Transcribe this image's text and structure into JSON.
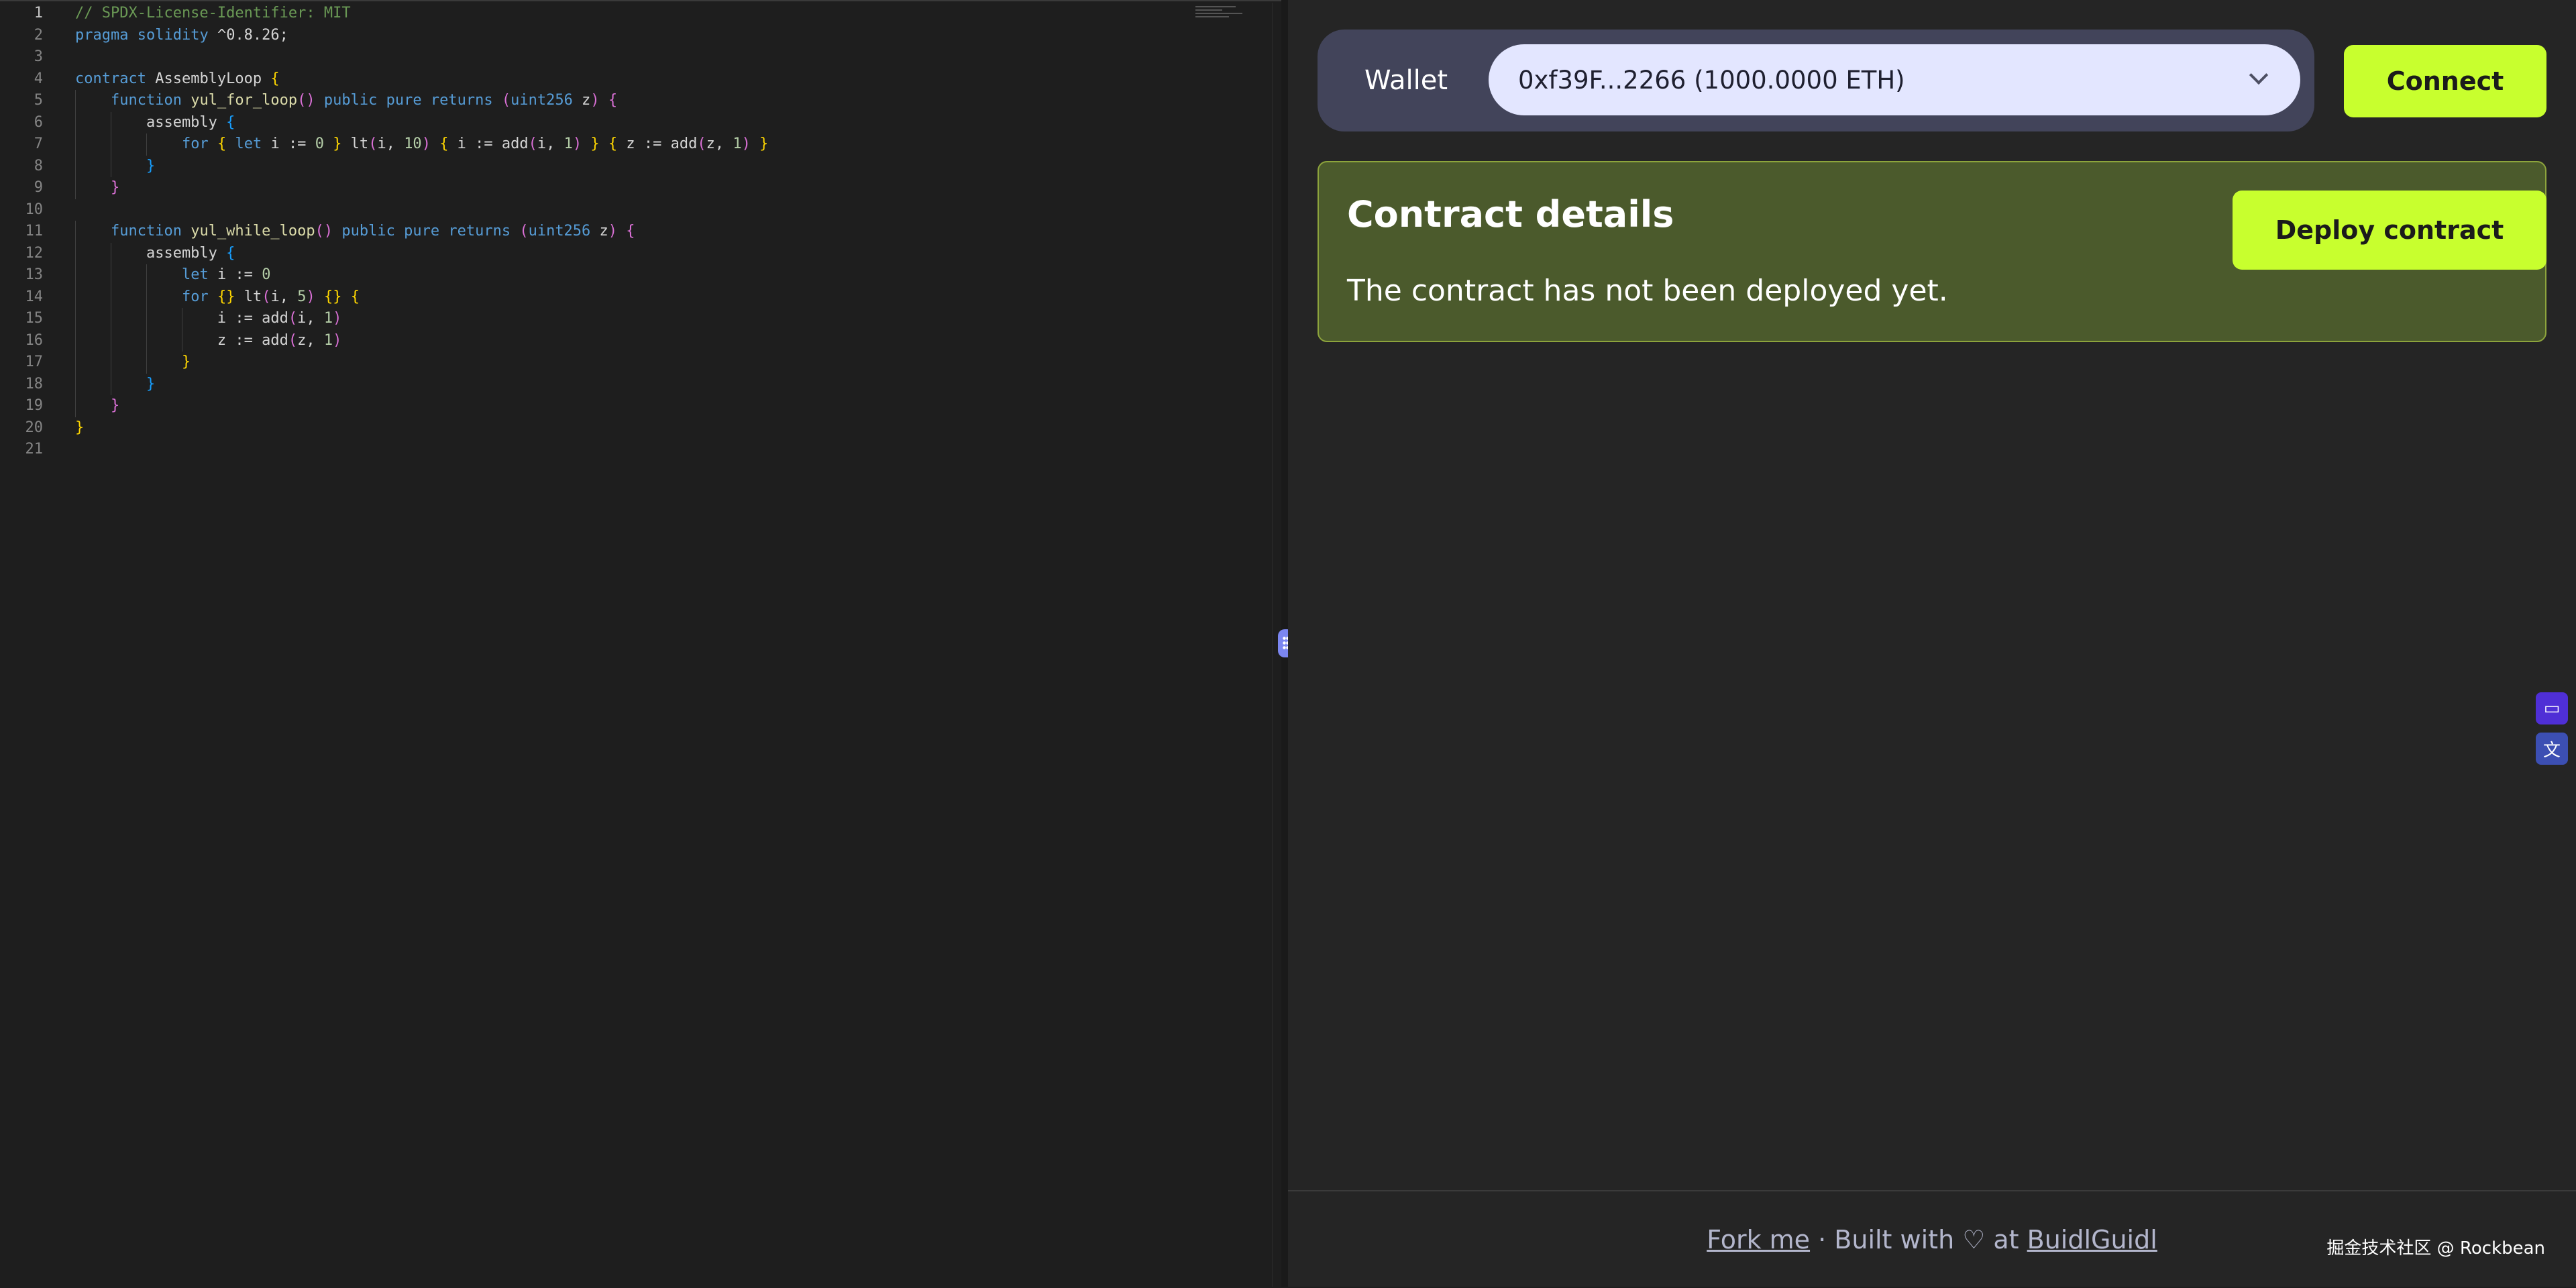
{
  "editor": {
    "lines": [
      [
        [
          "c-cm",
          "// SPDX-License-Identifier: MIT"
        ]
      ],
      [
        [
          "c-kw",
          "pragma"
        ],
        [
          "c-t",
          " "
        ],
        [
          "c-kw",
          "solidity"
        ],
        [
          "c-t",
          " ^0.8.26;"
        ]
      ],
      [],
      [
        [
          "c-kw",
          "contract"
        ],
        [
          "c-t",
          " AssemblyLoop "
        ],
        [
          "c-y",
          "{"
        ]
      ],
      [
        [
          "c-t",
          "    "
        ],
        [
          "c-kw",
          "function"
        ],
        [
          "c-t",
          " "
        ],
        [
          "c-fn",
          "yul_for_loop"
        ],
        [
          "c-m",
          "()"
        ],
        [
          "c-t",
          " "
        ],
        [
          "c-kw",
          "public"
        ],
        [
          "c-t",
          " "
        ],
        [
          "c-kw",
          "pure"
        ],
        [
          "c-t",
          " "
        ],
        [
          "c-kw",
          "returns"
        ],
        [
          "c-t",
          " "
        ],
        [
          "c-m",
          "("
        ],
        [
          "c-kw",
          "uint256"
        ],
        [
          "c-t",
          " z"
        ],
        [
          "c-m",
          ")"
        ],
        [
          "c-t",
          " "
        ],
        [
          "c-m",
          "{"
        ]
      ],
      [
        [
          "c-t",
          "        assembly "
        ],
        [
          "c-b",
          "{"
        ]
      ],
      [
        [
          "c-t",
          "            "
        ],
        [
          "c-kw",
          "for"
        ],
        [
          "c-t",
          " "
        ],
        [
          "c-y",
          "{"
        ],
        [
          "c-t",
          " "
        ],
        [
          "c-kw",
          "let"
        ],
        [
          "c-t",
          " i := "
        ],
        [
          "c-n",
          "0"
        ],
        [
          "c-t",
          " "
        ],
        [
          "c-y",
          "}"
        ],
        [
          "c-t",
          " lt"
        ],
        [
          "c-m",
          "("
        ],
        [
          "c-t",
          "i, "
        ],
        [
          "c-n",
          "10"
        ],
        [
          "c-m",
          ")"
        ],
        [
          "c-t",
          " "
        ],
        [
          "c-y",
          "{"
        ],
        [
          "c-t",
          " i := add"
        ],
        [
          "c-m",
          "("
        ],
        [
          "c-t",
          "i, "
        ],
        [
          "c-n",
          "1"
        ],
        [
          "c-m",
          ")"
        ],
        [
          "c-t",
          " "
        ],
        [
          "c-y",
          "}"
        ],
        [
          "c-t",
          " "
        ],
        [
          "c-y",
          "{"
        ],
        [
          "c-t",
          " z := add"
        ],
        [
          "c-m",
          "("
        ],
        [
          "c-t",
          "z, "
        ],
        [
          "c-n",
          "1"
        ],
        [
          "c-m",
          ")"
        ],
        [
          "c-t",
          " "
        ],
        [
          "c-y",
          "}"
        ]
      ],
      [
        [
          "c-t",
          "        "
        ],
        [
          "c-b",
          "}"
        ]
      ],
      [
        [
          "c-t",
          "    "
        ],
        [
          "c-m",
          "}"
        ]
      ],
      [],
      [
        [
          "c-t",
          "    "
        ],
        [
          "c-kw",
          "function"
        ],
        [
          "c-t",
          " "
        ],
        [
          "c-fn",
          "yul_while_loop"
        ],
        [
          "c-m",
          "()"
        ],
        [
          "c-t",
          " "
        ],
        [
          "c-kw",
          "public"
        ],
        [
          "c-t",
          " "
        ],
        [
          "c-kw",
          "pure"
        ],
        [
          "c-t",
          " "
        ],
        [
          "c-kw",
          "returns"
        ],
        [
          "c-t",
          " "
        ],
        [
          "c-m",
          "("
        ],
        [
          "c-kw",
          "uint256"
        ],
        [
          "c-t",
          " z"
        ],
        [
          "c-m",
          ")"
        ],
        [
          "c-t",
          " "
        ],
        [
          "c-m",
          "{"
        ]
      ],
      [
        [
          "c-t",
          "        assembly "
        ],
        [
          "c-b",
          "{"
        ]
      ],
      [
        [
          "c-t",
          "            "
        ],
        [
          "c-kw",
          "let"
        ],
        [
          "c-t",
          " i := "
        ],
        [
          "c-n",
          "0"
        ]
      ],
      [
        [
          "c-t",
          "            "
        ],
        [
          "c-kw",
          "for"
        ],
        [
          "c-t",
          " "
        ],
        [
          "c-y",
          "{}"
        ],
        [
          "c-t",
          " lt"
        ],
        [
          "c-m",
          "("
        ],
        [
          "c-t",
          "i, "
        ],
        [
          "c-n",
          "5"
        ],
        [
          "c-m",
          ")"
        ],
        [
          "c-t",
          " "
        ],
        [
          "c-y",
          "{}"
        ],
        [
          "c-t",
          " "
        ],
        [
          "c-y",
          "{"
        ]
      ],
      [
        [
          "c-t",
          "                i := add"
        ],
        [
          "c-m",
          "("
        ],
        [
          "c-t",
          "i, "
        ],
        [
          "c-n",
          "1"
        ],
        [
          "c-m",
          ")"
        ]
      ],
      [
        [
          "c-t",
          "                z := add"
        ],
        [
          "c-m",
          "("
        ],
        [
          "c-t",
          "z, "
        ],
        [
          "c-n",
          "1"
        ],
        [
          "c-m",
          ")"
        ]
      ],
      [
        [
          "c-t",
          "            "
        ],
        [
          "c-y",
          "}"
        ]
      ],
      [
        [
          "c-t",
          "        "
        ],
        [
          "c-b",
          "}"
        ]
      ],
      [
        [
          "c-t",
          "    "
        ],
        [
          "c-m",
          "}"
        ]
      ],
      [
        [
          "c-y",
          "}"
        ]
      ],
      []
    ]
  },
  "wallet": {
    "label": "Wallet",
    "selected": "0xf39F...2266 (1000.0000 ETH)",
    "connect_label": "Connect"
  },
  "contract": {
    "title": "Contract details",
    "status": "The contract has not been deployed yet.",
    "deploy_label": "Deploy contract"
  },
  "footer": {
    "fork_label": "Fork me",
    "built_with": " · Built with ♡ at ",
    "buidl_label": "BuidlGuidl"
  },
  "watermark": "掘金技术社区 @ Rockbean",
  "icons": {
    "side_a": "screen-chat-icon",
    "side_b": "translate-icon"
  }
}
